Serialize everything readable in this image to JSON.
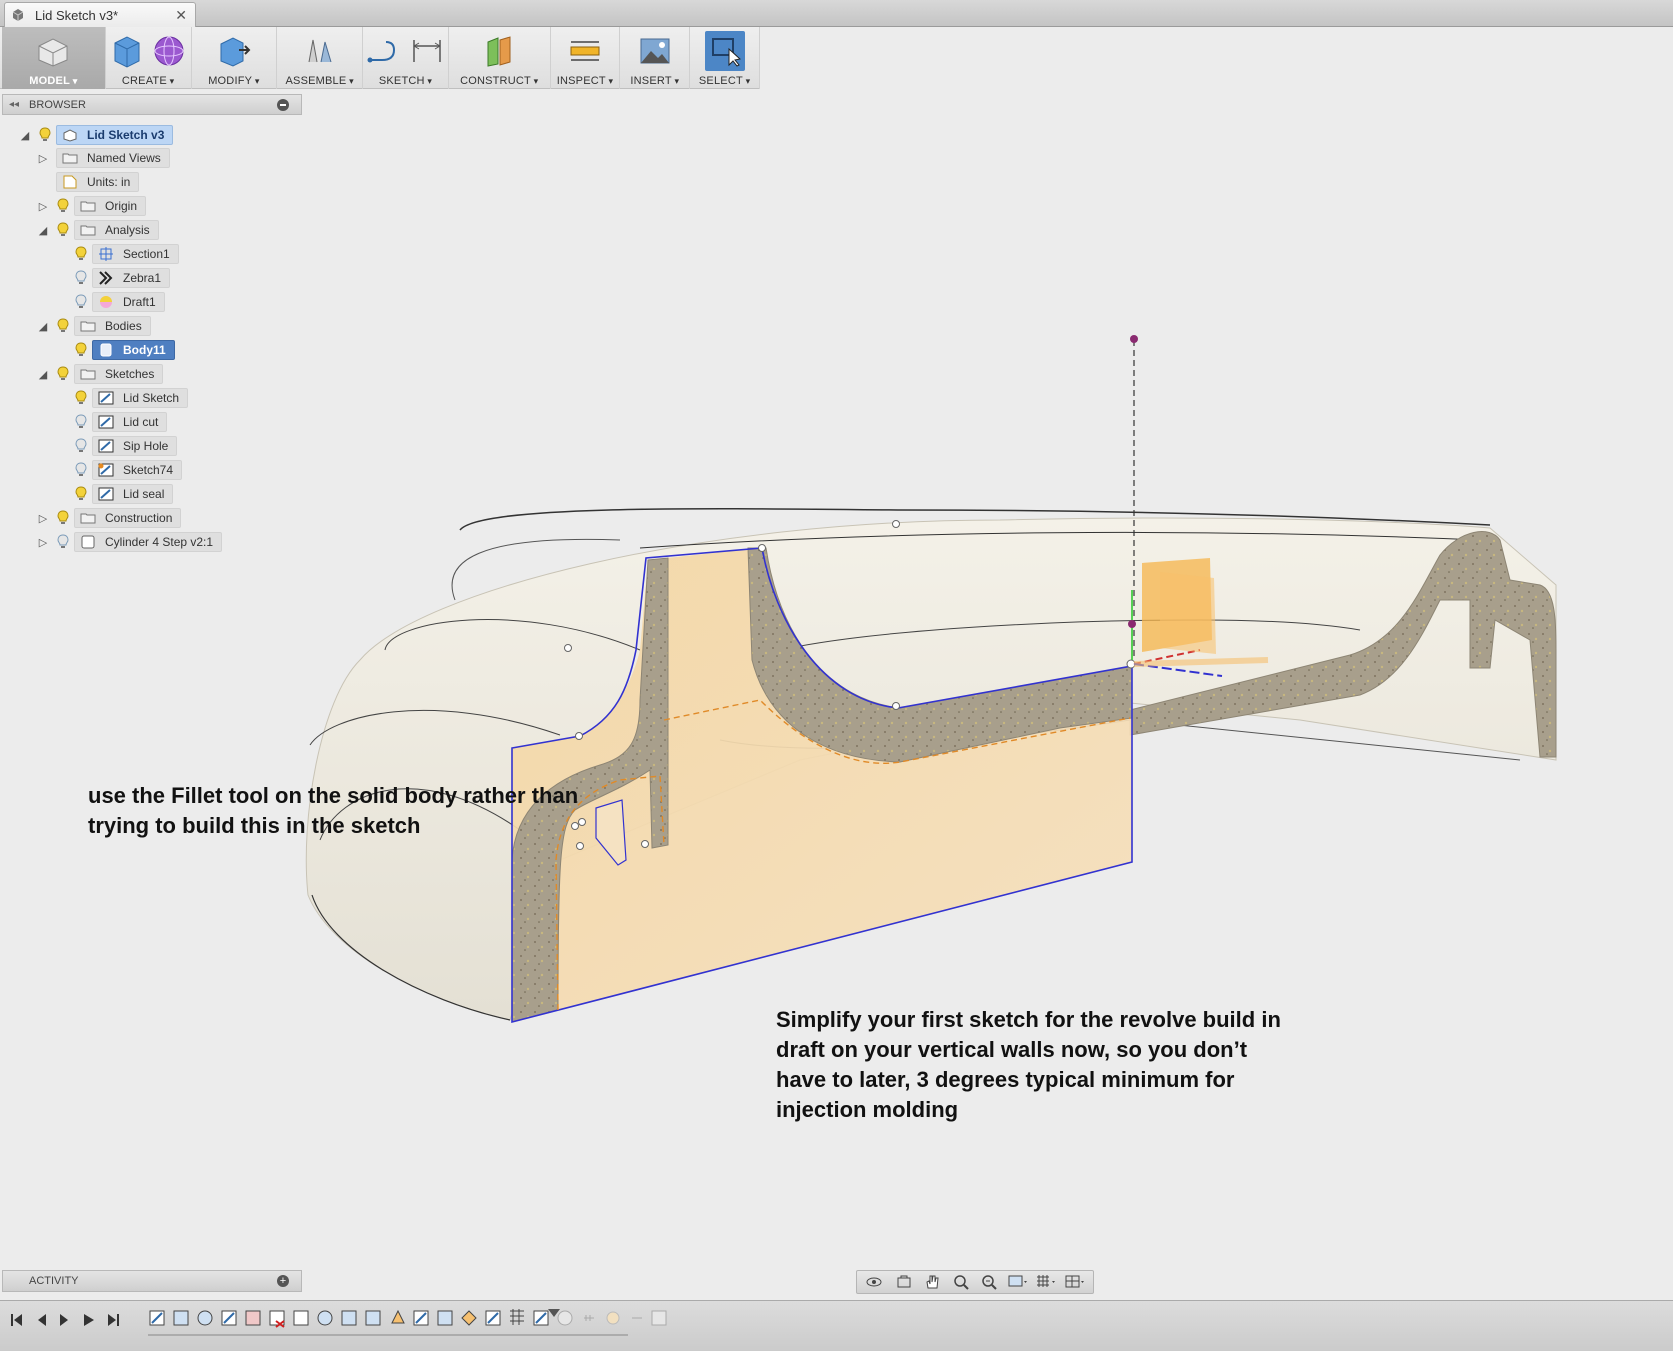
{
  "tab": {
    "title": "Lid Sketch v3*",
    "close": "✕"
  },
  "toolbar": {
    "model": "MODEL",
    "create": "CREATE",
    "modify": "MODIFY",
    "assemble": "ASSEMBLE",
    "sketch": "SKETCH",
    "construct": "CONSTRUCT",
    "inspect": "INSPECT",
    "insert": "INSERT",
    "select": "SELECT"
  },
  "browser": {
    "header": "BROWSER",
    "items": [
      {
        "label": "Lid Sketch v3",
        "state": "selected"
      },
      {
        "label": "Named Views"
      },
      {
        "label": "Units: in"
      },
      {
        "label": "Origin"
      },
      {
        "label": "Analysis"
      },
      {
        "label": "Section1"
      },
      {
        "label": "Zebra1"
      },
      {
        "label": "Draft1"
      },
      {
        "label": "Bodies"
      },
      {
        "label": "Body11",
        "state": "active"
      },
      {
        "label": "Sketches"
      },
      {
        "label": "Lid Sketch"
      },
      {
        "label": "Lid cut"
      },
      {
        "label": "Sip Hole"
      },
      {
        "label": "Sketch74"
      },
      {
        "label": "Lid seal"
      },
      {
        "label": "Construction"
      },
      {
        "label": "Cylinder 4 Step v2:1"
      }
    ]
  },
  "annotations": {
    "fillet": "use the Fillet tool on the solid body rather than trying to build this in the sketch",
    "draft": "Simplify your first sketch for the revolve build in draft on your vertical walls now, so you don’t have to later, 3 degrees typical minimum for injection molding"
  },
  "activity": {
    "header": "ACTIVITY"
  },
  "colors": {
    "accent": "#4c86c6",
    "profile": "#f5d9a8",
    "section": "#a79a82"
  }
}
